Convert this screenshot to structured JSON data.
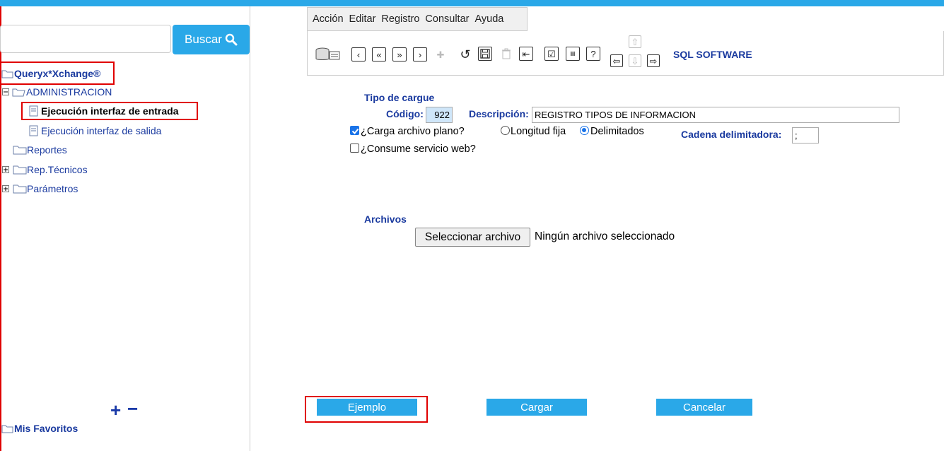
{
  "search": {
    "button_label": "Buscar",
    "placeholder": ""
  },
  "tree": {
    "root": "Queryx*Xchange®",
    "items": [
      {
        "label": "ADMINISTRACION"
      },
      {
        "label": "Ejecución interfaz de entrada"
      },
      {
        "label": "Ejecución interfaz de salida"
      },
      {
        "label": "Reportes"
      },
      {
        "label": "Rep.Técnicos"
      },
      {
        "label": "Parámetros"
      }
    ],
    "add_label": "+",
    "remove_label": "−",
    "favorites": "Mis Favoritos"
  },
  "menu": [
    "Acción",
    "Editar",
    "Registro",
    "Consultar",
    "Ayuda"
  ],
  "toolbar": {
    "brand": "SQL SOFTWARE"
  },
  "form": {
    "section_title": "Tipo de cargue",
    "codigo_label": "Código:",
    "codigo_value": "922",
    "descripcion_label": "Descripción:",
    "descripcion_value": "REGISTRO TIPOS DE INFORMACION",
    "carga_plano_label": "¿Carga archivo plano?",
    "longitud_fija_label": "Longitud fija",
    "delimitados_label": "Delimitados",
    "cadena_label": "Cadena delimitadora:",
    "cadena_value": ";",
    "servicio_web_label": "¿Consume servicio web?",
    "archivos_title": "Archivos",
    "file_button": "Seleccionar archivo",
    "file_status": "Ningún archivo seleccionado"
  },
  "actions": {
    "ejemplo": "Ejemplo",
    "cargar": "Cargar",
    "cancelar": "Cancelar"
  },
  "colors": {
    "accent": "#2aa8e8",
    "link": "#1a3a9f",
    "highlight": "#e00000"
  }
}
